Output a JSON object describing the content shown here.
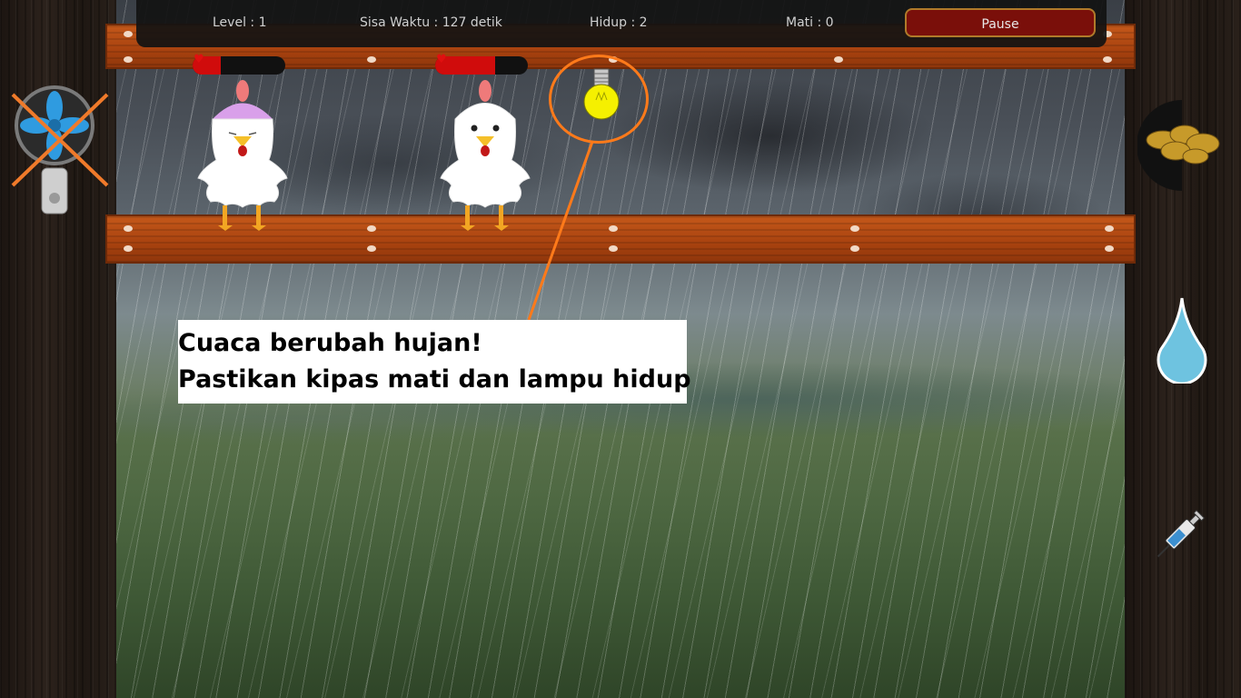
{
  "topbar": {
    "level_text": "Level : 1",
    "time_text": "Sisa Waktu : 127 detik",
    "alive_text": "Hidup : 2",
    "dead_text": "Mati : 0",
    "pause_label": "Pause"
  },
  "chickens": [
    {
      "health_percent": 30,
      "hat_color": "#d9a0ea"
    },
    {
      "health_percent": 65,
      "hat_color": null
    }
  ],
  "tools": {
    "fan": {
      "icon": "fan-icon",
      "state": "off"
    },
    "lamp": {
      "icon": "light-bulb-icon",
      "state": "on",
      "color": "#f5f000"
    },
    "feed": {
      "icon": "feed-icon"
    },
    "water": {
      "icon": "water-drop-icon",
      "color": "#6ec3e0"
    },
    "vaccine": {
      "icon": "syringe-icon"
    }
  },
  "message": {
    "line1": "Cuaca berubah hujan!",
    "line2": "Pastikan kipas mati dan lampu hidup"
  },
  "colors": {
    "accent_orange": "#ff7a1a",
    "pause_bg": "#7a0f0a",
    "health_red": "#d00c0c",
    "wood": "#b54a12"
  }
}
